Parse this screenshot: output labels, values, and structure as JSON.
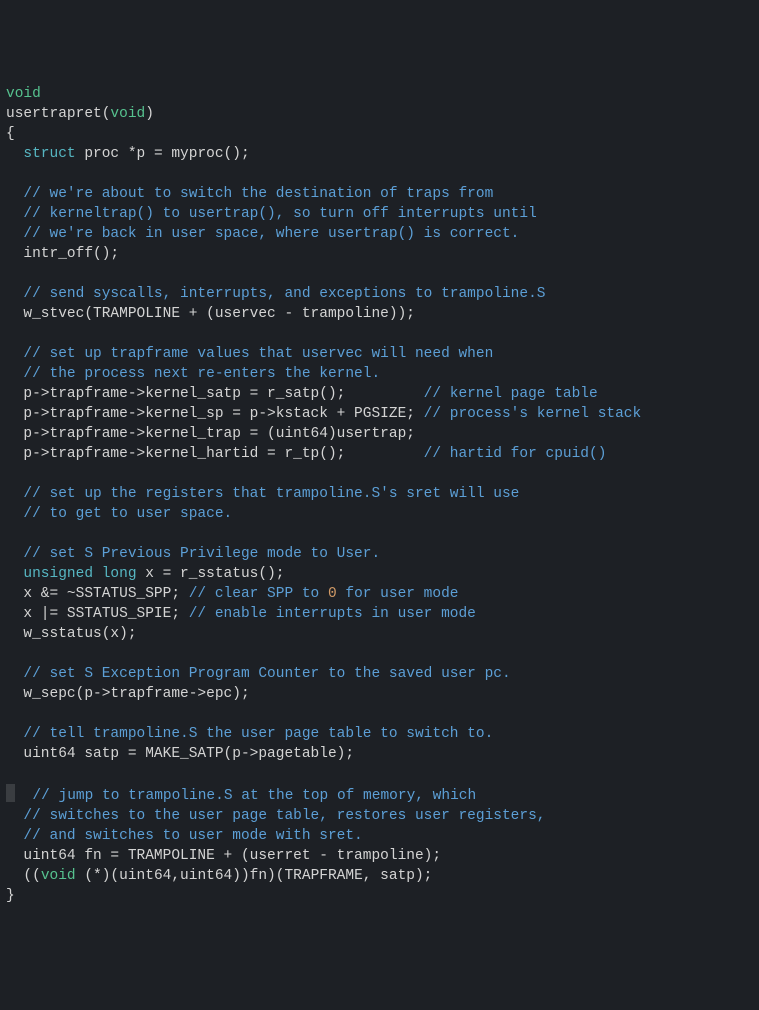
{
  "code": {
    "l1a": "void",
    "l2a": "usertrapret(",
    "l2b": "void",
    "l2c": ")",
    "l3": "{",
    "l4a": "  ",
    "l4b": "struct",
    "l4c": " proc *p = myproc();",
    "l6": "  // we're about to switch the destination of traps from",
    "l7": "  // kerneltrap() to usertrap(), so turn off interrupts until",
    "l8": "  // we're back in user space, where usertrap() is correct.",
    "l9": "  intr_off();",
    "l11": "  // send syscalls, interrupts, and exceptions to trampoline.S",
    "l12": "  w_stvec(TRAMPOLINE + (uservec - trampoline));",
    "l14": "  // set up trapframe values that uservec will need when",
    "l15": "  // the process next re-enters the kernel.",
    "l16a": "  p->trapframe->kernel_satp = r_satp();         ",
    "l16b": "// kernel page table",
    "l17a": "  p->trapframe->kernel_sp = p->kstack + PGSIZE; ",
    "l17b": "// process's kernel stack",
    "l18": "  p->trapframe->kernel_trap = (uint64)usertrap;",
    "l19a": "  p->trapframe->kernel_hartid = r_tp();         ",
    "l19b": "// hartid for cpuid()",
    "l21": "  // set up the registers that trampoline.S's sret will use",
    "l22": "  // to get to user space.",
    "l24": "  // set S Previous Privilege mode to User.",
    "l25a": "  ",
    "l25b": "unsigned",
    "l25c": " ",
    "l25d": "long",
    "l25e": " x = r_sstatus();",
    "l26a": "  x &= ~SSTATUS_SPP; ",
    "l26b": "// clear SPP to ",
    "l26c": "0",
    "l26d": " for user mode",
    "l27a": "  x |= SSTATUS_SPIE; ",
    "l27b": "// enable interrupts in user mode",
    "l28": "  w_sstatus(x);",
    "l30": "  // set S Exception Program Counter to the saved user pc.",
    "l31": "  w_sepc(p->trapframe->epc);",
    "l33": "  // tell trampoline.S the user page table to switch to.",
    "l34": "  uint64 satp = MAKE_SATP(p->pagetable);",
    "l36": "  // jump to trampoline.S at the top of memory, which",
    "l37": "  // switches to the user page table, restores user registers,",
    "l38": "  // and switches to user mode with sret.",
    "l39": "  uint64 fn = TRAMPOLINE + (userret - trampoline);",
    "l40a": "  ((",
    "l40b": "void",
    "l40c": " (*)(uint64,uint64))fn)(TRAPFRAME, satp);",
    "l41": "}"
  }
}
